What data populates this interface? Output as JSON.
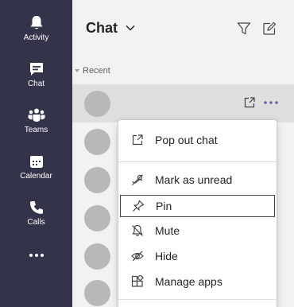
{
  "rail": {
    "items": [
      {
        "label": "Activity",
        "icon": "bell-icon"
      },
      {
        "label": "Chat",
        "icon": "chat-icon"
      },
      {
        "label": "Teams",
        "icon": "teams-icon"
      },
      {
        "label": "Calendar",
        "icon": "calendar-icon"
      },
      {
        "label": "Calls",
        "icon": "phone-icon"
      },
      {
        "label": "",
        "icon": "more-icon"
      }
    ],
    "active": "Chat",
    "background": "#33344a"
  },
  "header": {
    "title": "Chat",
    "filter_icon": "filter-icon",
    "new_chat_icon": "compose-icon"
  },
  "list": {
    "section_label": "Recent",
    "row_count": 6,
    "selected_row_actions": [
      "popout-icon",
      "more-options-icon"
    ]
  },
  "context_menu": {
    "items": [
      {
        "label": "Pop out chat",
        "icon": "popout-icon"
      },
      {
        "label": "Mark as unread",
        "icon": "mark-unread-icon"
      },
      {
        "label": "Pin",
        "icon": "pin-icon"
      },
      {
        "label": "Mute",
        "icon": "mute-icon"
      },
      {
        "label": "Hide",
        "icon": "hide-icon"
      },
      {
        "label": "Manage apps",
        "icon": "apps-icon"
      }
    ],
    "hovered": "Pin"
  },
  "colors": {
    "accent": "#6264a7",
    "selected_row": "#e1dfdd",
    "panel_bg": "#f3f2f1"
  }
}
